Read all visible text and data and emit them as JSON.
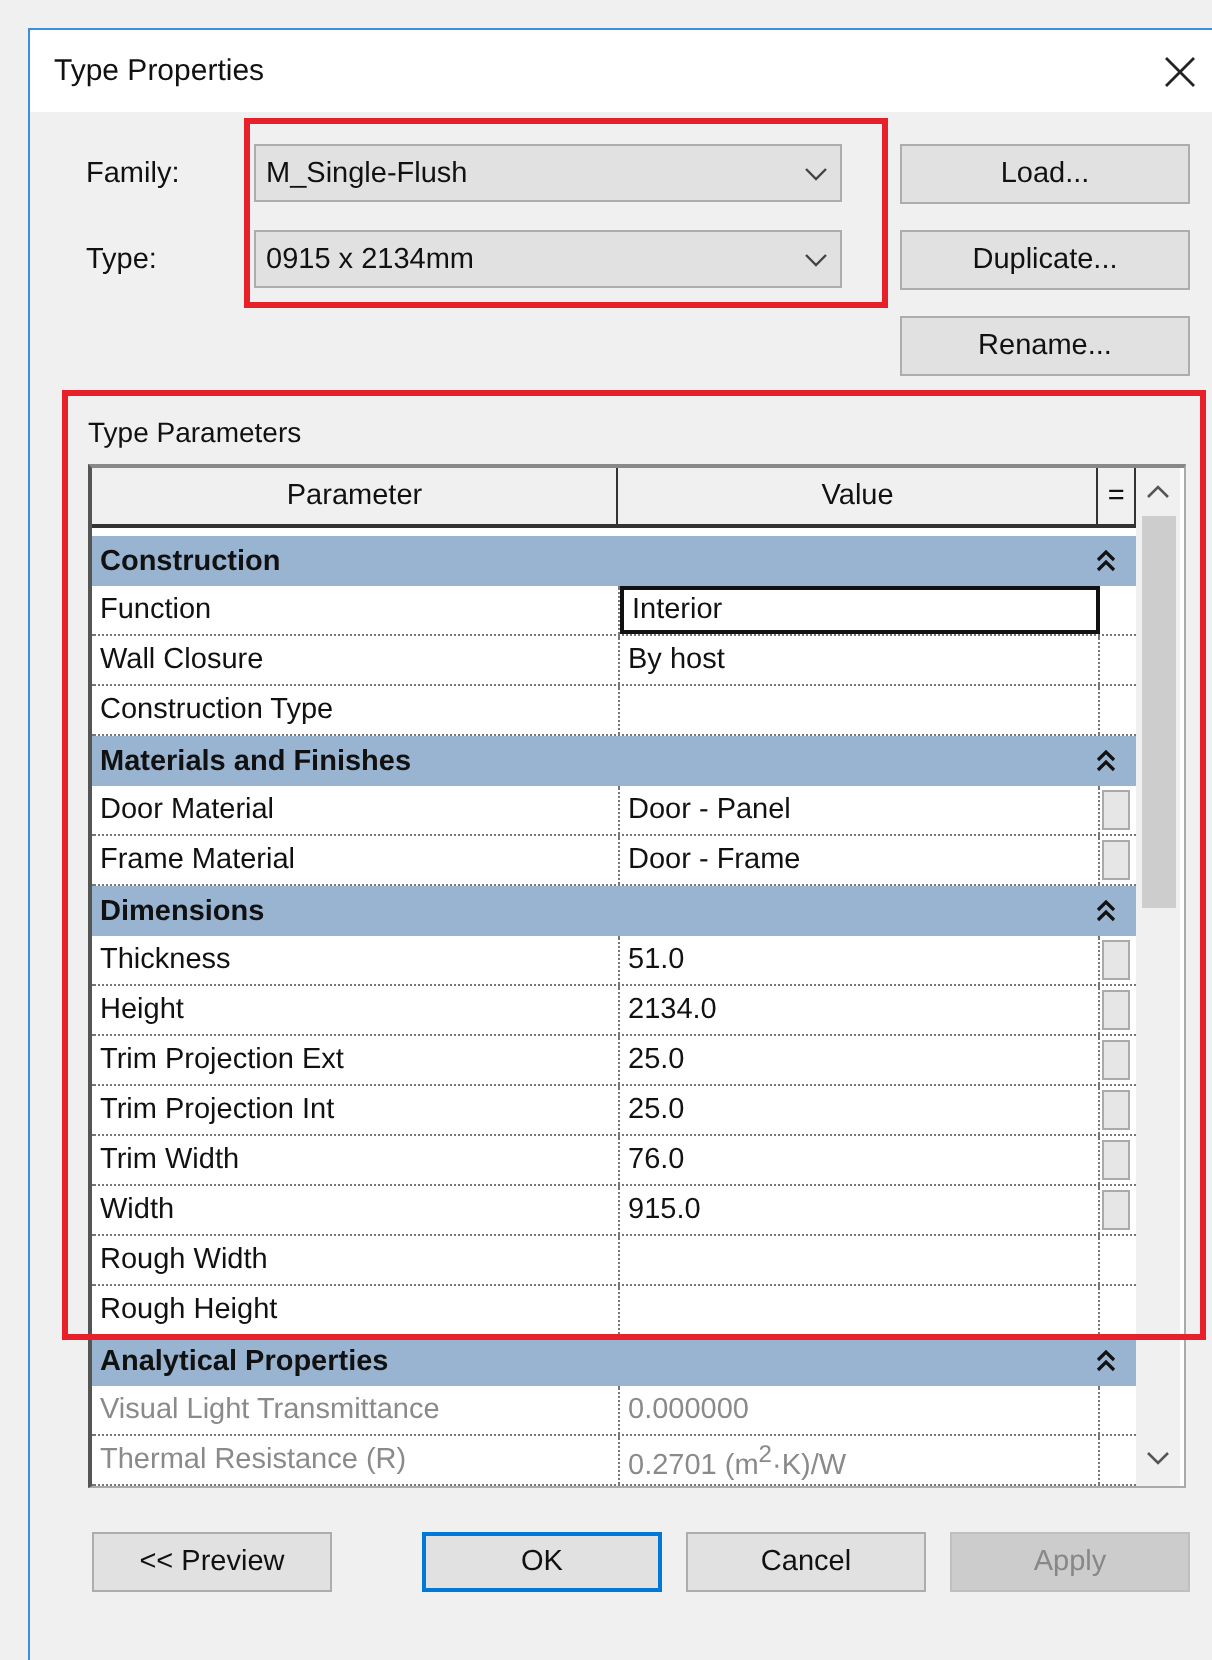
{
  "window": {
    "title": "Type Properties"
  },
  "fields": [
    {
      "label": "Family:",
      "value": "M_Single-Flush"
    },
    {
      "label": "Type:",
      "value": "0915 x 2134mm"
    }
  ],
  "side_buttons": [
    "Load...",
    "Duplicate...",
    "Rename..."
  ],
  "parameters": {
    "label": "Type Parameters",
    "columns": [
      "Parameter",
      "Value",
      "="
    ],
    "rows": [
      {
        "kind": "group",
        "name": "Construction",
        "expanded": true
      },
      {
        "kind": "param",
        "name": "Function",
        "value": "Interior",
        "selected": true,
        "has_button": false,
        "disabled": false
      },
      {
        "kind": "param",
        "name": "Wall Closure",
        "value": "By host",
        "selected": false,
        "has_button": false,
        "disabled": false
      },
      {
        "kind": "param",
        "name": "Construction Type",
        "selected": false,
        "has_button": false,
        "disabled": false
      },
      {
        "kind": "group",
        "name": "Materials and Finishes",
        "expanded": true
      },
      {
        "kind": "param",
        "name": "Door Material",
        "value": "Door - Panel",
        "selected": false,
        "has_button": true,
        "disabled": false
      },
      {
        "kind": "param",
        "name": "Frame Material",
        "value": "Door - Frame",
        "selected": false,
        "has_button": true,
        "disabled": false
      },
      {
        "kind": "group",
        "name": "Dimensions",
        "expanded": true
      },
      {
        "kind": "param",
        "name": "Thickness",
        "value": "51.0",
        "selected": false,
        "has_button": true,
        "disabled": false
      },
      {
        "kind": "param",
        "name": "Height",
        "value": "2134.0",
        "selected": false,
        "has_button": true,
        "disabled": false
      },
      {
        "kind": "param",
        "name": "Trim Projection Ext",
        "value": "25.0",
        "selected": false,
        "has_button": true,
        "disabled": false
      },
      {
        "kind": "param",
        "name": "Trim Projection Int",
        "value": "25.0",
        "selected": false,
        "has_button": true,
        "disabled": false
      },
      {
        "kind": "param",
        "name": "Trim Width",
        "value": "76.0",
        "selected": false,
        "has_button": true,
        "disabled": false
      },
      {
        "kind": "param",
        "name": "Width",
        "value": "915.0",
        "selected": false,
        "has_button": true,
        "disabled": false
      },
      {
        "kind": "param",
        "name": "Rough Width",
        "selected": false,
        "has_button": false,
        "disabled": false
      },
      {
        "kind": "param",
        "name": "Rough Height",
        "selected": false,
        "has_button": false,
        "disabled": false
      },
      {
        "kind": "group",
        "name": "Analytical Properties",
        "expanded": true
      },
      {
        "kind": "param",
        "name": "Visual Light Transmittance",
        "value": "0.000000",
        "selected": false,
        "has_button": false,
        "disabled": true
      },
      {
        "kind": "param",
        "name": "Thermal Resistance (R)",
        "value": "0.2701 (m$^{2}$·K)/W",
        "selected": false,
        "has_button": false,
        "disabled": true
      }
    ]
  },
  "buttons": [
    {
      "label": "<< Preview",
      "default": false,
      "disabled": false
    },
    {
      "label": "OK",
      "default": true,
      "disabled": false
    },
    {
      "label": "Cancel",
      "default": false,
      "disabled": false
    },
    {
      "label": "Apply",
      "default": false,
      "disabled": true
    }
  ]
}
